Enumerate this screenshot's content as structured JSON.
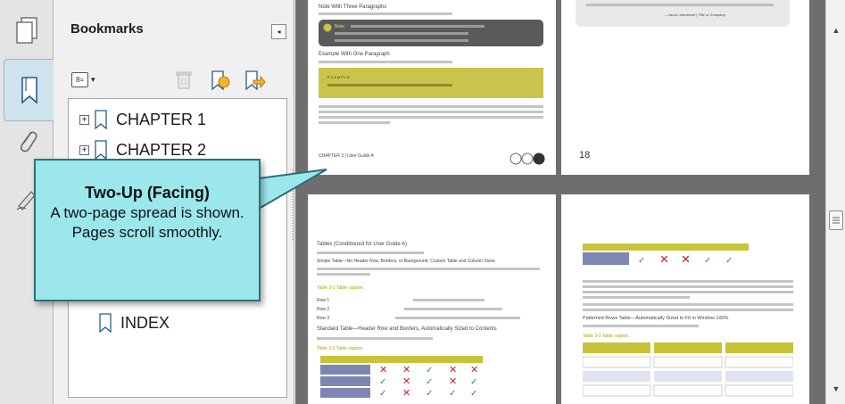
{
  "panel": {
    "title": "Bookmarks",
    "collapse_glyph": "◂"
  },
  "toolbar": {
    "options_glyph": "8=",
    "options_caret": "▾",
    "icons": [
      "options-icon",
      "delete-bookmark-icon",
      "new-bookmark-icon",
      "bookmark-properties-icon"
    ]
  },
  "bookmarks": [
    {
      "label": "CHAPTER 1",
      "expander": "+"
    },
    {
      "label": "CHAPTER 2",
      "expander": "+"
    },
    {
      "label": "INDEX",
      "expander": ""
    }
  ],
  "callout": {
    "title": "Two-Up (Facing)",
    "body": "A two-page spread is shown. Pages scroll smoothly."
  },
  "pages": {
    "p1": {
      "heading": "Note With Three Paragraphs",
      "note_label": "Note:",
      "example_heading": "Example With One Paragraph",
      "example_label": "E X A M P L E",
      "footer": "CHAPTER 3 | User Guide A"
    },
    "p2": {
      "attribution": "—Jacob Johnstone | Title or Company",
      "page_number": "18"
    },
    "p3": {
      "title": "Tables (Conditioned for User Guide A)",
      "simple_heading": "Simple Table—No Header Row, Borders, or Background; Custom Table and Column Sizes",
      "caption1": "Table 3-1 Table caption.",
      "rows": [
        "Row 1",
        "Row 2",
        "Row 3"
      ],
      "standard_heading": "Standard Table—Header Row and Borders, Automatically Sized to Contents",
      "caption2": "Table 3-2 Table caption."
    },
    "p4": {
      "patterned_heading": "Patterned Rows Table—Automatically Sized to Fit in Window 100%",
      "caption3": "Table 3-3 Table caption."
    }
  },
  "colors": {
    "callout_fill": "#9be7ec",
    "table_header": "#c8c43a",
    "note_box": "#5a5a5a",
    "example_box": "#c9c44c",
    "row_fill": "#7e86b4",
    "panel_bg": "#f0f0f0",
    "doc_bg": "#6e6e6e"
  }
}
